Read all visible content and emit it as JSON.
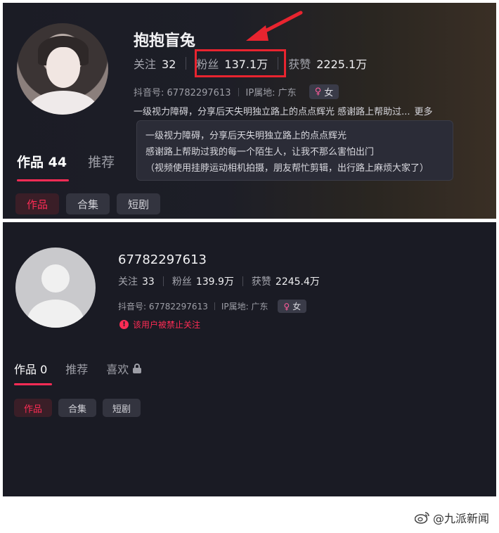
{
  "top": {
    "name": "抱抱盲兔",
    "stats": [
      {
        "label": "关注",
        "value": "32"
      },
      {
        "label": "粉丝",
        "value": "137.1万"
      },
      {
        "label": "获赞",
        "value": "2225.1万"
      }
    ],
    "douyin_id": "抖音号: 67782297613",
    "ip_location": "IP属地: 广东",
    "gender": "女",
    "bio_preview": "一级视力障碍，分享后天失明独立路上的点点辉光 感谢路上帮助过...",
    "bio_more": "更多",
    "bio_full": [
      "一级视力障碍，分享后天失明独立路上的点点辉光",
      "感谢路上帮助过我的每一个陌生人，让我不那么害怕出门",
      "（视频使用挂脖运动相机拍摄，朋友帮忙剪辑，出行路上麻烦大家了）"
    ],
    "tabs": [
      {
        "label": "作品 44"
      },
      {
        "label": "推荐"
      }
    ],
    "chips": [
      "作品",
      "合集",
      "短剧"
    ]
  },
  "bottom": {
    "name": "67782297613",
    "stats": [
      {
        "label": "关注",
        "value": "33"
      },
      {
        "label": "粉丝",
        "value": "139.9万"
      },
      {
        "label": "获赞",
        "value": "2245.4万"
      }
    ],
    "douyin_id": "抖音号: 67782297613",
    "ip_location": "IP属地: 广东",
    "gender": "女",
    "ban_notice": "该用户被禁止关注",
    "tabs": [
      {
        "label": "作品 0"
      },
      {
        "label": "推荐"
      },
      {
        "label": "喜欢"
      }
    ],
    "chips": [
      "作品",
      "合集",
      "短剧"
    ]
  },
  "watermark": "@九派新闻",
  "colors": {
    "accent": "#fe2c55",
    "highlight": "#e8242f",
    "background": "#1c1d26"
  }
}
